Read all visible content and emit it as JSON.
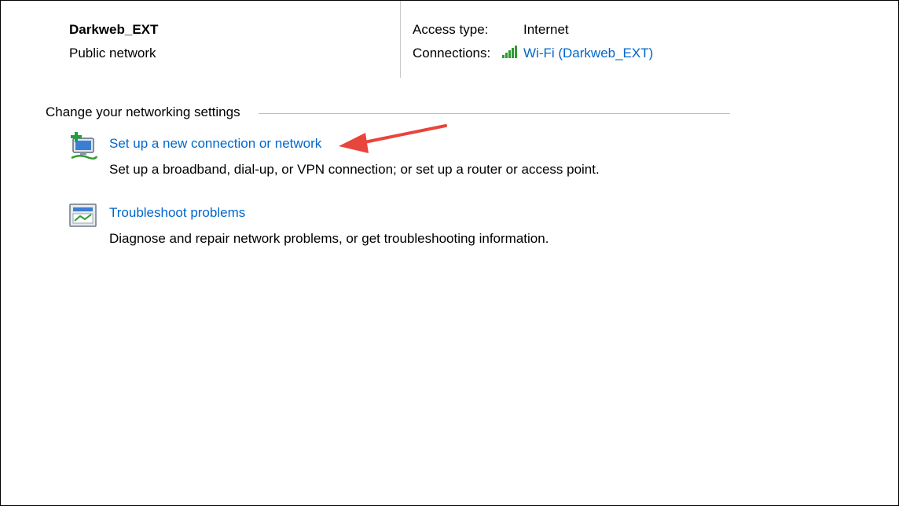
{
  "network": {
    "name": "Darkweb_EXT",
    "category": "Public network"
  },
  "details": {
    "access_type_label": "Access type:",
    "access_type_value": "Internet",
    "connections_label": "Connections:",
    "connection_link": "Wi-Fi (Darkweb_EXT)"
  },
  "settings": {
    "heading": "Change your networking settings",
    "items": [
      {
        "title": "Set up a new connection or network",
        "description": "Set up a broadband, dial-up, or VPN connection; or set up a router or access point.",
        "icon": "new-connection-icon"
      },
      {
        "title": "Troubleshoot problems",
        "description": "Diagnose and repair network problems, or get troubleshooting information.",
        "icon": "troubleshoot-icon"
      }
    ]
  },
  "annotation": {
    "arrow_color": "#e8453c",
    "icon": "red-arrow-icon"
  },
  "colors": {
    "link": "#0066cc",
    "divider": "#c0c0c0",
    "wifi": "#2e9b2e"
  }
}
